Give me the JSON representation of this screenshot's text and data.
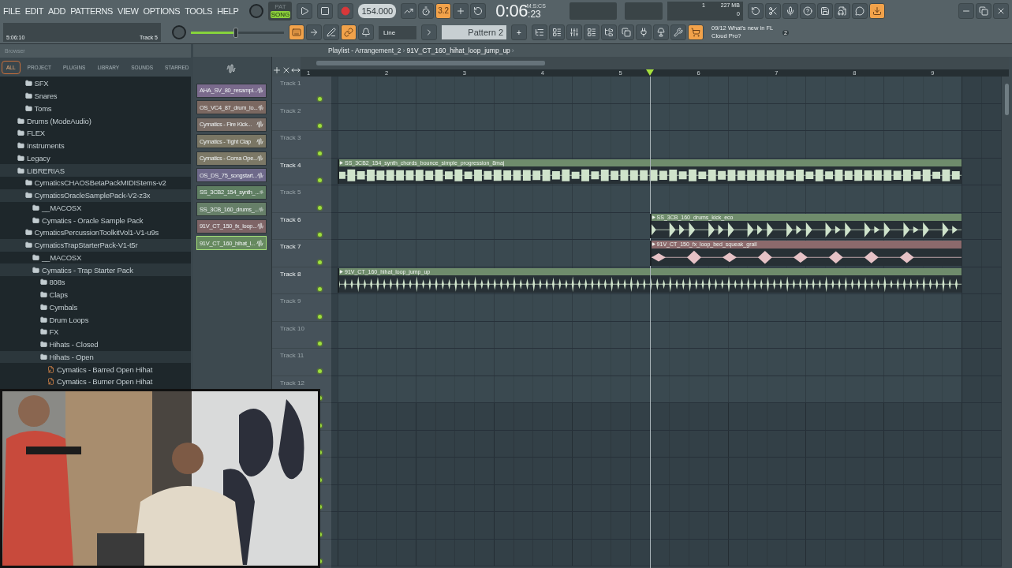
{
  "menu": [
    "FILE",
    "EDIT",
    "ADD",
    "PATTERNS",
    "VIEW",
    "OPTIONS",
    "TOOLS",
    "HELP"
  ],
  "mode": [
    {
      "label": "PAT",
      "selected": false
    },
    {
      "label": "SONG",
      "selected": true
    }
  ],
  "tempo": "154.000",
  "time": {
    "value": "0:06",
    "fraction": ":23",
    "unit": "M:S:CS"
  },
  "hint": {
    "time": "5:06:10",
    "target": "Track 5"
  },
  "master_volume": {
    "level": 0.48
  },
  "monitor": {
    "polyphony": "1",
    "memory": "227 MB",
    "value_2": "0"
  },
  "tools_1": [
    {
      "on": false
    },
    {
      "on": false
    },
    {
      "label": "3.2",
      "on": true
    },
    {
      "on": false
    },
    {
      "on": false
    }
  ],
  "tools_2": [
    {
      "on": false
    },
    {
      "on": false
    },
    {
      "on": false
    },
    {
      "on": false
    },
    {
      "on": false
    },
    {
      "on": false
    },
    {
      "on": false
    },
    {
      "on": true
    }
  ],
  "tools_3": [
    {
      "on": true
    },
    {
      "on": false
    },
    {
      "on": false
    },
    {
      "on": true
    },
    {
      "on": false
    }
  ],
  "snap": {
    "value": "Line"
  },
  "pattern": {
    "value": "Pattern 2",
    "add": "+"
  },
  "tools_4": [
    {
      "on": false
    },
    {
      "on": false
    },
    {
      "on": false
    },
    {
      "on": false
    },
    {
      "on": false
    },
    {
      "on": false
    },
    {
      "on": false
    },
    {
      "on": false
    },
    {
      "on": false
    },
    {
      "on": true
    }
  ],
  "news": {
    "date": "09/12",
    "text": "What's new in FL Cloud Pro?",
    "badge": "2"
  },
  "browser": {
    "title": "Browser",
    "tabs": [
      {
        "label": "ALL",
        "selected": true
      },
      {
        "label": "PROJECT",
        "selected": false
      },
      {
        "label": "PLUGINS",
        "selected": false
      },
      {
        "label": "LIBRARY",
        "selected": false
      },
      {
        "label": "SOUNDS",
        "selected": false
      },
      {
        "label": "STARRED",
        "selected": false
      }
    ],
    "tree": [
      {
        "children": [
          {
            "label": "SFX",
            "kind": "folder",
            "expanded": false
          },
          {
            "label": "Snares",
            "kind": "folder",
            "expanded": false
          },
          {
            "label": "Toms",
            "kind": "folder",
            "expanded": false
          }
        ]
      },
      {
        "label": "Drums (ModeAudio)",
        "kind": "folder",
        "expanded": false
      },
      {
        "label": "FLEX",
        "kind": "folder",
        "expanded": false
      },
      {
        "label": "Instruments",
        "kind": "folder",
        "expanded": false
      },
      {
        "label": "Legacy",
        "kind": "folder",
        "expanded": false
      },
      {
        "label": "LIBRERIAS",
        "kind": "folder",
        "expanded": true,
        "children": [
          {
            "label": "CymaticsCHAOSBetaPackMIDIStems-v2",
            "kind": "folder",
            "expanded": false
          },
          {
            "label": "CymaticsOracleSamplePack-V2-z3x",
            "kind": "folder",
            "expanded": true,
            "children": [
              {
                "label": "__MACOSX",
                "kind": "folder",
                "expanded": false
              },
              {
                "label": "Cymatics - Oracle Sample Pack",
                "kind": "folder",
                "expanded": false
              }
            ]
          },
          {
            "label": "CymaticsPercussionToolkitVol1-V1-u9s",
            "kind": "folder",
            "expanded": false
          },
          {
            "label": "CymaticsTrapStarterPack-V1-t5r",
            "kind": "folder",
            "expanded": true,
            "children": [
              {
                "label": "__MACOSX",
                "kind": "folder",
                "expanded": false
              },
              {
                "label": "Cymatics - Trap Starter Pack",
                "kind": "folder",
                "expanded": true,
                "children": [
                  {
                    "label": "808s",
                    "kind": "folder",
                    "expanded": false
                  },
                  {
                    "label": "Claps",
                    "kind": "folder",
                    "expanded": false
                  },
                  {
                    "label": "Cymbals",
                    "kind": "folder",
                    "expanded": false
                  },
                  {
                    "label": "Drum Loops",
                    "kind": "folder",
                    "expanded": false
                  },
                  {
                    "label": "FX",
                    "kind": "folder",
                    "expanded": false
                  },
                  {
                    "label": "Hihats - Closed",
                    "kind": "folder",
                    "expanded": false
                  },
                  {
                    "label": "Hihats - Open",
                    "kind": "folder",
                    "expanded": true,
                    "children": [
                      {
                        "label": "Cymatics - Barred Open Hihat",
                        "kind": "file"
                      },
                      {
                        "label": "Cymatics - Burner Open Hihat",
                        "kind": "file"
                      }
                    ]
                  }
                ]
              }
            ]
          }
        ]
      }
    ]
  },
  "channels": [
    {
      "name": "AHA_SV_80_resampl...",
      "color": "#7a6a8c",
      "selected": false
    },
    {
      "name": "OS_VC4_87_drum_lo...",
      "color": "#7b6861",
      "selected": false
    },
    {
      "name": "Cymatics - Fire Kick...",
      "color": "#7a6d66",
      "selected": false
    },
    {
      "name": "Cymatics - Tight Clap",
      "color": "#7a7664",
      "selected": false
    },
    {
      "name": "Cymatics - Coma Ope...",
      "color": "#7c7866",
      "selected": false
    },
    {
      "name": "OS_DS_75_songstart...",
      "color": "#6e698a",
      "selected": false
    },
    {
      "name": "SS_3CB2_154_synth_...",
      "color": "#5f7e62",
      "selected": false
    },
    {
      "name": "SS_3CB_160_drums_...",
      "color": "#667f68",
      "selected": false
    },
    {
      "name": "91V_CT_150_fx_loop...",
      "color": "#7e6466",
      "selected": false
    },
    {
      "name": "91V_CT_160_hihat_l...",
      "color": "#66895f",
      "selected": true
    }
  ],
  "playlist": {
    "crumbs": [
      {
        "kind": "title",
        "text": "Playlist - Arrangement_2"
      },
      {
        "kind": "separator",
        "text": "›"
      },
      {
        "kind": "pattern",
        "text": "91V_CT_160_hihat_loop_jump_up"
      },
      {
        "kind": "separator",
        "text": "›"
      }
    ],
    "ruler": [
      "1",
      "2",
      "3",
      "4",
      "5",
      "6",
      "7",
      "8",
      "9"
    ],
    "playhead": {
      "level": 0.5
    },
    "tracks": [
      {
        "name": "Track 1"
      },
      {
        "name": "Track 2"
      },
      {
        "name": "Track 3"
      },
      {
        "name": "Track 4",
        "clips": [
          {
            "name": "SS_3CB2_154_synth_chords_bounce_simple_progression_8maj",
            "start": {
              "level": 0
            },
            "end": {
              "level": 1
            },
            "color": "#6f8c6c",
            "kind": "chords"
          }
        ]
      },
      {
        "name": "Track 5"
      },
      {
        "name": "Track 6",
        "clips": [
          {
            "name": "SS_3CB_160_drums_kick_eco",
            "start": {
              "level": 0.5
            },
            "end": {
              "level": 1
            },
            "color": "#6f8c6c",
            "kind": "kick"
          }
        ]
      },
      {
        "name": "Track 7",
        "clips": [
          {
            "name": "91V_CT_150_fx_loop_bed_squeak_grail",
            "start": {
              "level": 0.5
            },
            "end": {
              "level": 1
            },
            "color": "#8c6a6c",
            "kind": "swell"
          }
        ]
      },
      {
        "name": "Track 8",
        "clips": [
          {
            "name": "91V_CT_160_hihat_loop_jump_up",
            "start": {
              "level": 0
            },
            "end": {
              "level": 1
            },
            "color": "#6f8c6c",
            "kind": "hihat"
          }
        ]
      },
      {
        "name": "Track 9"
      },
      {
        "name": "Track 10"
      },
      {
        "name": "Track 11"
      },
      {
        "name": "Track 12"
      }
    ]
  }
}
